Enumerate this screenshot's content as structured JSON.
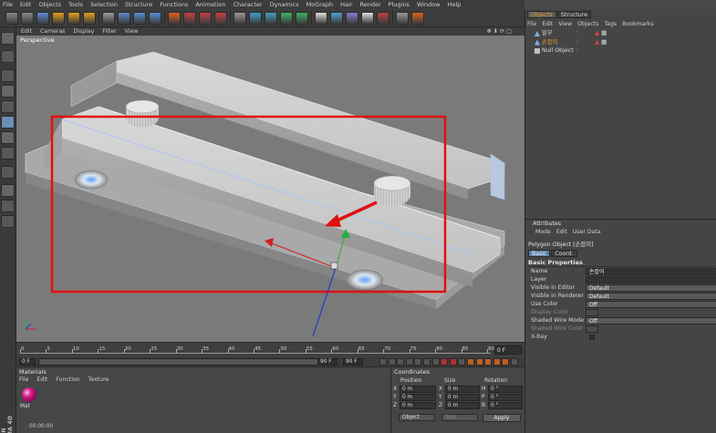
{
  "menu": [
    "File",
    "Edit",
    "Objects",
    "Tools",
    "Selection",
    "Structure",
    "Functions",
    "Animation",
    "Character",
    "Dynamics",
    "MoGraph",
    "Hair",
    "Render",
    "Plugins",
    "Window",
    "Help"
  ],
  "viewport": {
    "menu": [
      "Edit",
      "Cameras",
      "Display",
      "Filter",
      "View"
    ],
    "label": "Perspective",
    "nav_icons": "✥⬇⟳▢"
  },
  "timeline": {
    "ticks": [
      "0",
      "5",
      "10",
      "15",
      "20",
      "25",
      "30",
      "35",
      "40",
      "45",
      "50",
      "55",
      "60",
      "65",
      "70",
      "75",
      "80",
      "85",
      "90"
    ],
    "current_frame": "0 F",
    "start_field": "0 F",
    "end_field": "90 F",
    "end_field2": "90 F",
    "min_field": "0 F"
  },
  "materials": {
    "title": "Materials",
    "menu": [
      "File",
      "Edit",
      "Function",
      "Texture"
    ],
    "items": [
      {
        "name": "Mat"
      }
    ],
    "timecode": "00:00:00",
    "brand": "MAXON CINEMA 4D",
    "color": "#d2167f"
  },
  "coordinates": {
    "title": "Coordinates",
    "headers": [
      "Position",
      "Size",
      "Rotation"
    ],
    "rows": [
      {
        "axis": "X",
        "pos": "0 m",
        "size_axis": "X",
        "size": "0 m",
        "rot_axis": "H",
        "rot": "0 °"
      },
      {
        "axis": "Y",
        "pos": "0 m",
        "size_axis": "Y",
        "size": "0 m",
        "rot_axis": "P",
        "rot": "0 °"
      },
      {
        "axis": "Z",
        "pos": "0 m",
        "size_axis": "Z",
        "size": "0 m",
        "rot_axis": "B",
        "rot": "0 °"
      }
    ],
    "mode": "Object",
    "size_mode": "Size",
    "apply": "Apply"
  },
  "objects": {
    "tabs": [
      "Objects",
      "Structure"
    ],
    "menu": [
      "File",
      "Edit",
      "View",
      "Objects",
      "Tags",
      "Bookmarks"
    ],
    "rows": [
      {
        "name": "밑부",
        "color": "#dcdcdc",
        "icon_color": "#7fb0e0"
      },
      {
        "name": "손잡이",
        "color": "#f0a030",
        "icon_color": "#7fb0e0"
      },
      {
        "name": "Null Object",
        "color": "#dcdcdc",
        "icon_color": "#c0c0c0"
      }
    ]
  },
  "attributes": {
    "title": "Attributes",
    "menu": [
      "Mode",
      "Edit",
      "User Data"
    ],
    "object_name": "Polygon Object [손잡이]",
    "tabs": [
      "Basic",
      "Coord."
    ],
    "section": "Basic Properties",
    "props": [
      {
        "label": "Name",
        "value": "손잡이",
        "kind": "field"
      },
      {
        "label": "Layer",
        "value": "",
        "kind": "field"
      },
      {
        "label": "Visible in Editor",
        "value": "Default",
        "kind": "select"
      },
      {
        "label": "Visible in Renderer",
        "value": "Default",
        "kind": "select"
      },
      {
        "label": "Use Color",
        "value": "Off",
        "kind": "select"
      },
      {
        "label": "Display Color",
        "value": "",
        "kind": "dim"
      },
      {
        "label": "Shaded Wire Mode",
        "value": "Off",
        "kind": "select"
      },
      {
        "label": "Shaded Wire Color",
        "value": "",
        "kind": "dim"
      },
      {
        "label": "X-Ray",
        "value": "",
        "kind": "check"
      }
    ]
  },
  "colors": {
    "highlight_box": "#e01010",
    "axis_x": "#d02020",
    "axis_y": "#20b040",
    "axis_z": "#2040d0"
  }
}
